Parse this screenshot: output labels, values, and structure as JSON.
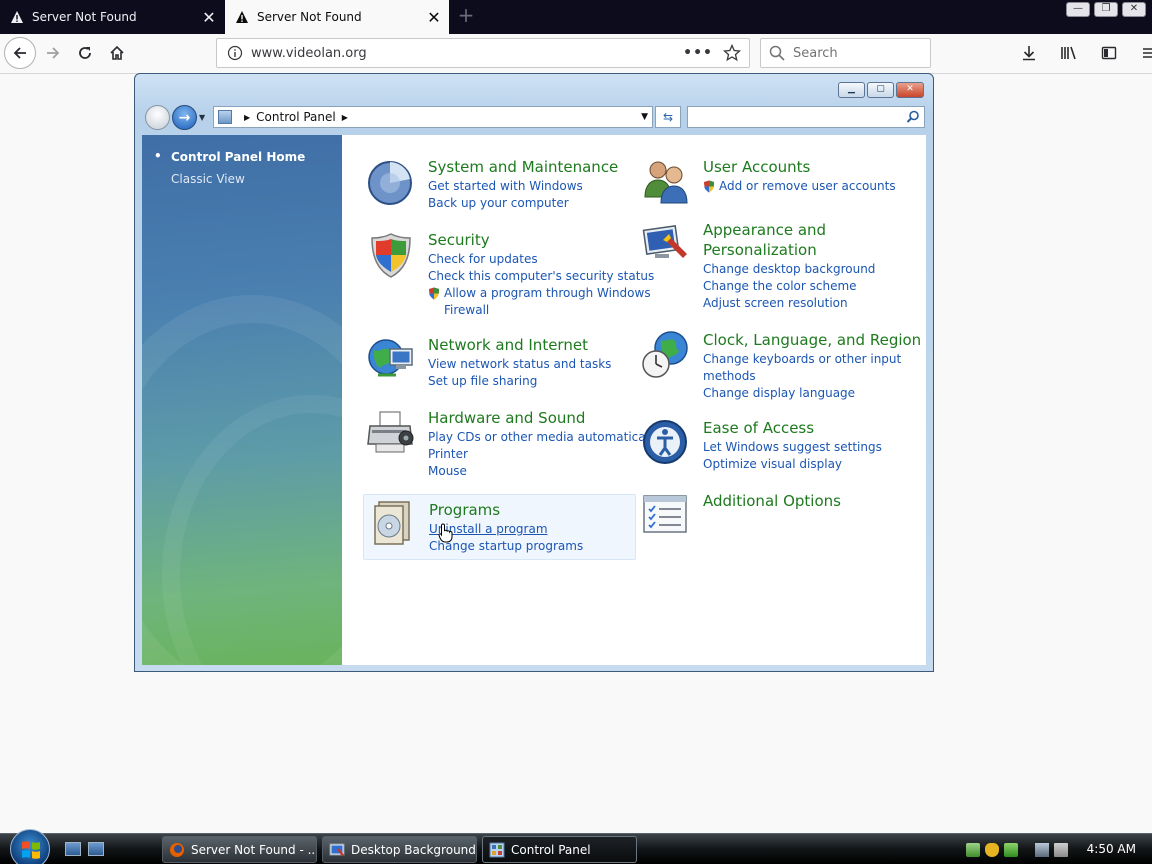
{
  "browser": {
    "tabs": [
      {
        "title": "Server Not Found",
        "active": false
      },
      {
        "title": "Server Not Found",
        "active": true
      }
    ],
    "url": "www.videolan.org",
    "search_placeholder": "Search"
  },
  "control_panel": {
    "address": "Control Panel",
    "sidebar": {
      "home": "Control Panel Home",
      "classic": "Classic View"
    },
    "categories": [
      {
        "title": "System and Maintenance",
        "links": [
          "Get started with Windows",
          "Back up your computer"
        ]
      },
      {
        "title": "Security",
        "links": [
          "Check for updates",
          "Check this computer's security status"
        ],
        "shield_link": [
          "Allow a program through Windows",
          "Firewall"
        ]
      },
      {
        "title": "Network and Internet",
        "links": [
          "View network status and tasks",
          "Set up file sharing"
        ]
      },
      {
        "title": "Hardware and Sound",
        "links": [
          "Play CDs or other media automatically",
          "Printer",
          "Mouse"
        ]
      },
      {
        "title": "Programs",
        "links": [
          "Uninstall a program",
          "Change startup programs"
        ]
      },
      {
        "title": "User Accounts",
        "shield_link": [
          "Add or remove user accounts"
        ]
      },
      {
        "title_lines": [
          "Appearance and",
          "Personalization"
        ],
        "links": [
          "Change desktop background",
          "Change the color scheme",
          "Adjust screen resolution"
        ]
      },
      {
        "title": "Clock, Language, and Region",
        "links": [
          "Change keyboards or other input",
          "methods",
          "Change display language"
        ]
      },
      {
        "title": "Ease of Access",
        "links": [
          "Let Windows suggest settings",
          "Optimize visual display"
        ]
      },
      {
        "title": "Additional Options"
      }
    ]
  },
  "taskbar": {
    "buttons": [
      "Server Not Found - ...",
      "Desktop Background",
      "Control Panel"
    ],
    "clock": "4:50 AM"
  },
  "colors": {
    "category_title": "#1e7a1e",
    "link": "#1b56b3",
    "tabstrip": "#0c0c1c"
  }
}
